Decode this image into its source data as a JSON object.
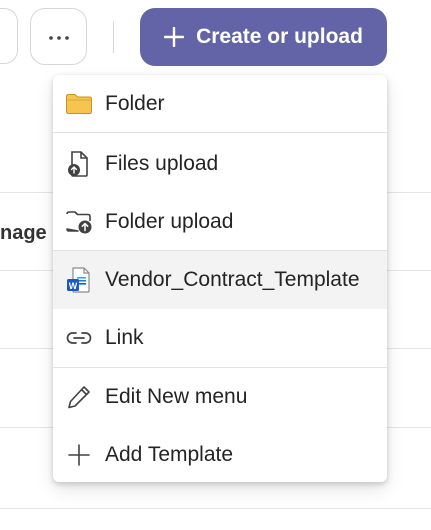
{
  "toolbar": {
    "more_icon": "ellipsis-icon",
    "create_button": {
      "label": "Create or upload",
      "icon": "plus-icon",
      "color": "#6264a7"
    }
  },
  "background": {
    "partial_text": "nage"
  },
  "menu": {
    "items": [
      {
        "label": "Folder",
        "icon": "folder-icon"
      },
      {
        "label": "Files upload",
        "icon": "file-upload-icon"
      },
      {
        "label": "Folder upload",
        "icon": "folder-upload-icon"
      },
      {
        "label": "Vendor_Contract_Template",
        "icon": "word-document-icon"
      },
      {
        "label": "Link",
        "icon": "link-icon"
      },
      {
        "label": "Edit New menu",
        "icon": "pencil-icon"
      },
      {
        "label": "Add Template",
        "icon": "plus-icon"
      }
    ]
  }
}
